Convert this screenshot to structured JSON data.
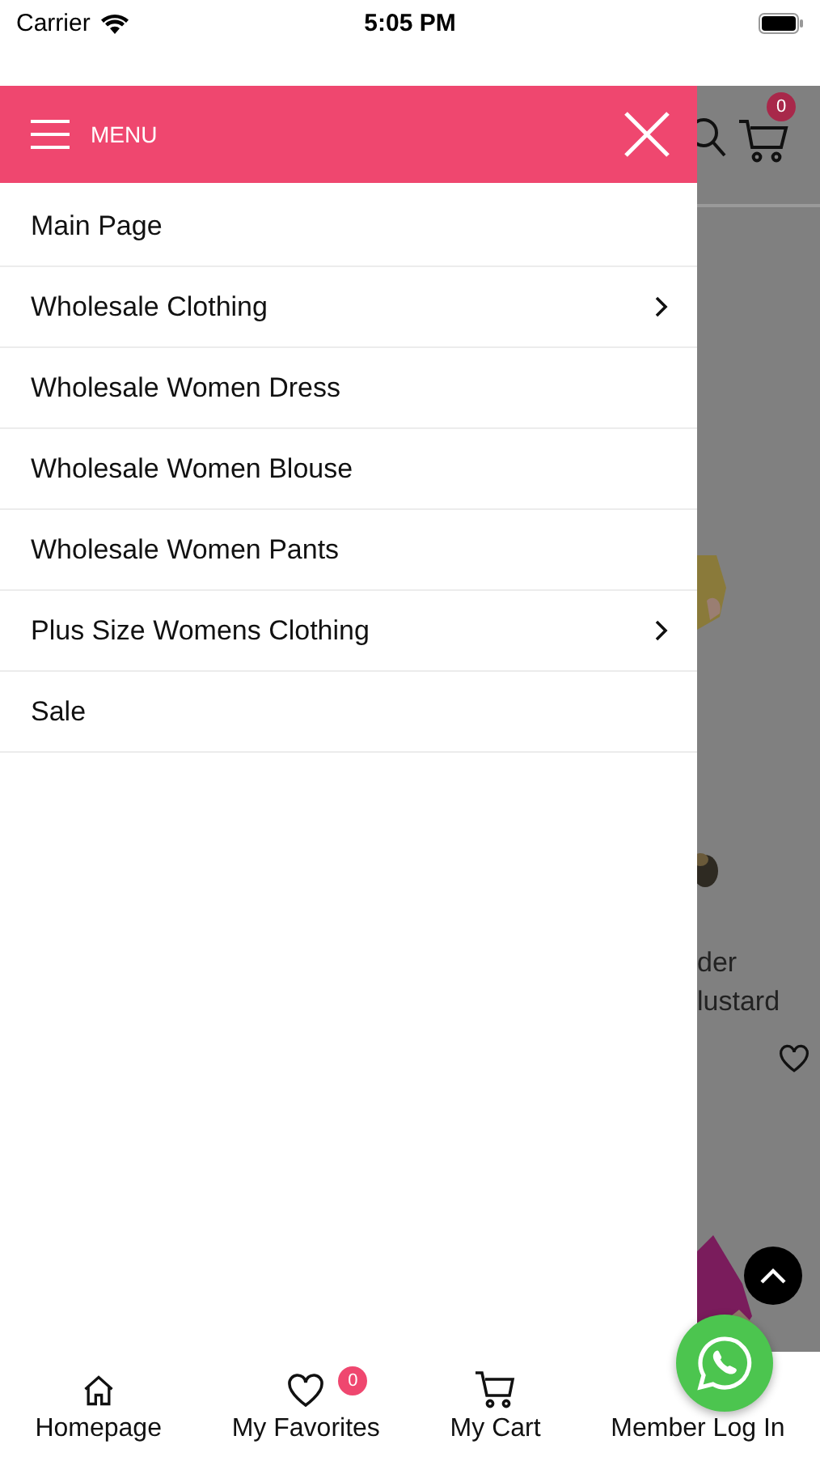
{
  "status_bar": {
    "carrier": "Carrier",
    "time": "5:05 PM"
  },
  "drawer": {
    "title": "MENU",
    "items": [
      {
        "label": "Main Page",
        "has_submenu": false
      },
      {
        "label": "Wholesale Clothing",
        "has_submenu": true
      },
      {
        "label": "Wholesale Women Dress",
        "has_submenu": false
      },
      {
        "label": "Wholesale Women Blouse",
        "has_submenu": false
      },
      {
        "label": "Wholesale Women Pants",
        "has_submenu": false
      },
      {
        "label": "Plus Size Womens Clothing",
        "has_submenu": true
      },
      {
        "label": "Sale",
        "has_submenu": false
      }
    ]
  },
  "background": {
    "cart_count": "0",
    "product_text_lines": [
      "der",
      "lustard"
    ]
  },
  "bottom_nav": [
    {
      "label": "Homepage",
      "kind": "home"
    },
    {
      "label": "My Favorites",
      "kind": "favorites",
      "badge": "0"
    },
    {
      "label": "My Cart",
      "kind": "cart"
    },
    {
      "label": "Member Log In",
      "kind": "login"
    }
  ]
}
